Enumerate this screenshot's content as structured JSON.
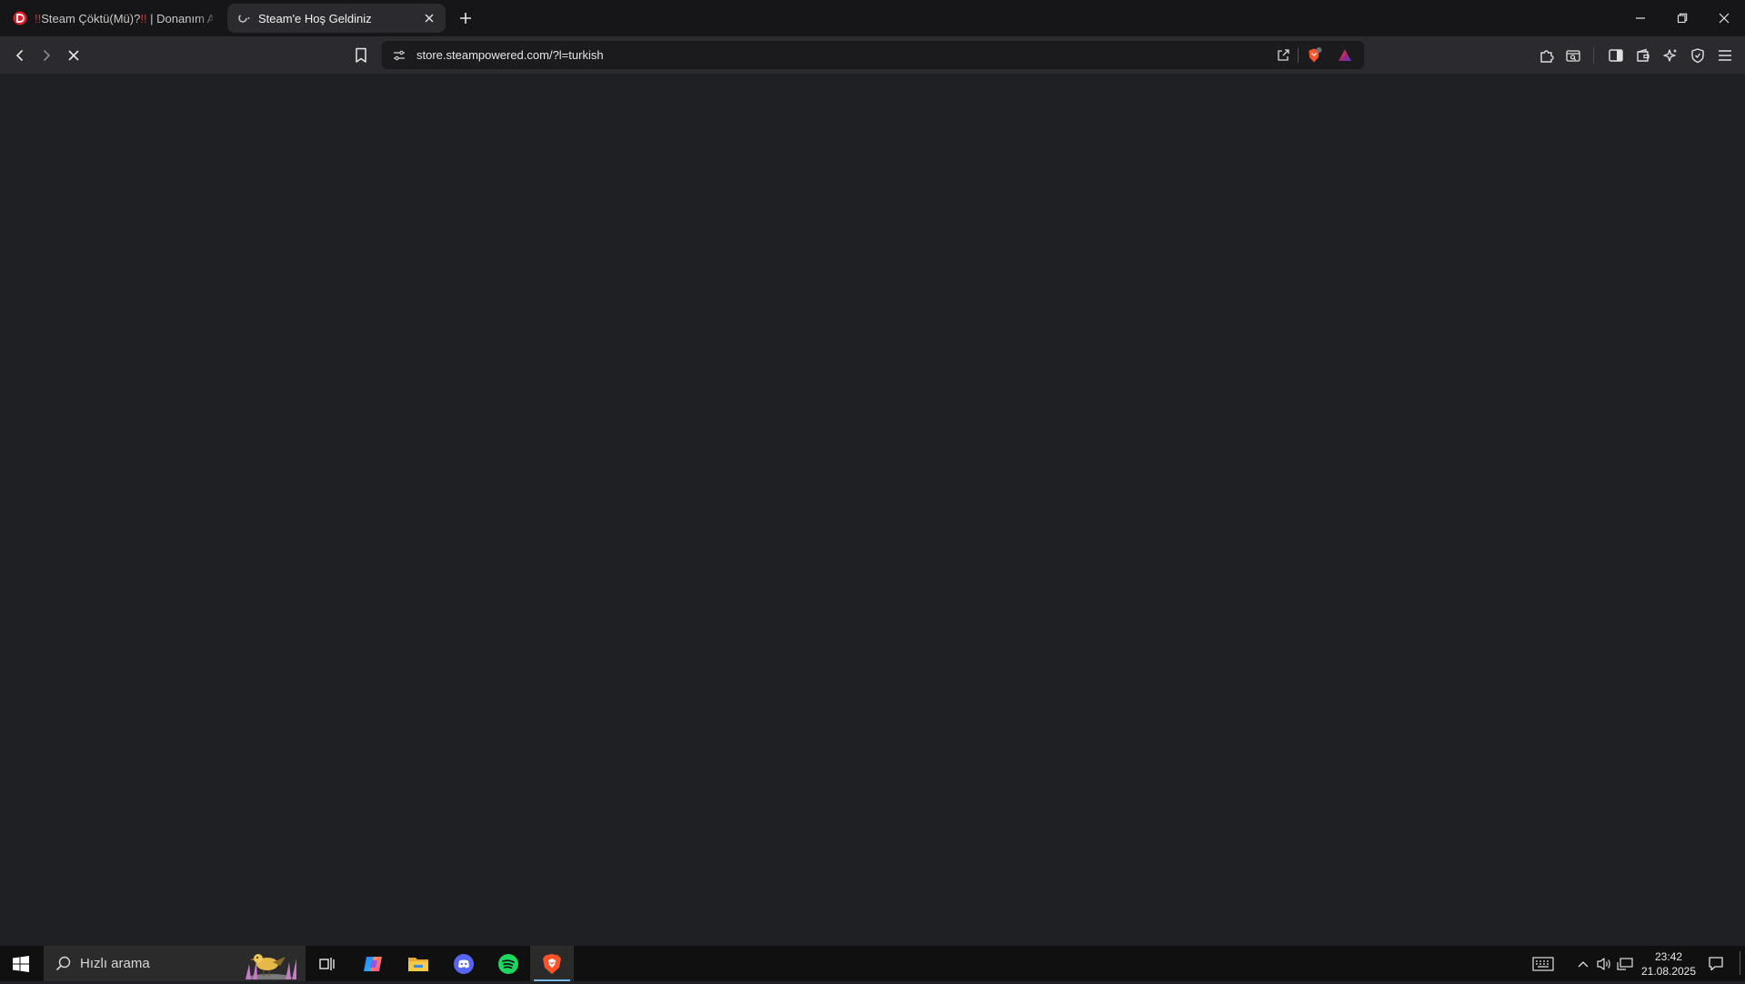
{
  "tabs": [
    {
      "title_prefix": "!!",
      "title_main": "Steam Çöktü(Mü)?",
      "title_suffix": "!!",
      "title_rest": " | Donanım Ar",
      "favicon": "donanimarsivi-logo-icon",
      "active": false
    },
    {
      "title": "Steam'e Hoş Geldiniz",
      "favicon": "loading-spinner-icon",
      "active": true
    }
  ],
  "address_bar": {
    "url": "store.steampowered.com/?l=turkish"
  },
  "toolbar_icons": [
    "back-icon",
    "forward-icon",
    "stop-loading-icon",
    "bookmark-icon",
    "site-info-icon",
    "share-icon",
    "brave-shields-icon",
    "brave-rewards-icon",
    "extensions-icon",
    "tab-search-icon",
    "sidebar-icon",
    "wallet-icon",
    "leo-ai-icon",
    "vpn-icon",
    "menu-icon"
  ],
  "window_controls": [
    "minimize-icon",
    "restore-icon",
    "close-icon"
  ],
  "colors": {
    "page_bg": "#1f2023",
    "tabstrip_bg": "#161618",
    "toolbar_bg": "#2b2b2f",
    "taskbar_bg": "#101010",
    "brave_orange": "#fb542b",
    "spotify_green": "#1ed760",
    "discord_blurple": "#5865f2"
  },
  "taskbar": {
    "search_placeholder": "Hızlı arama",
    "apps": [
      "task-view-icon",
      "copilot-icon",
      "file-explorer-icon",
      "discord-icon",
      "spotify-icon",
      "brave-browser-icon"
    ],
    "active_app": "brave-browser-icon",
    "time": "23:42",
    "date": "21.08.2025"
  }
}
